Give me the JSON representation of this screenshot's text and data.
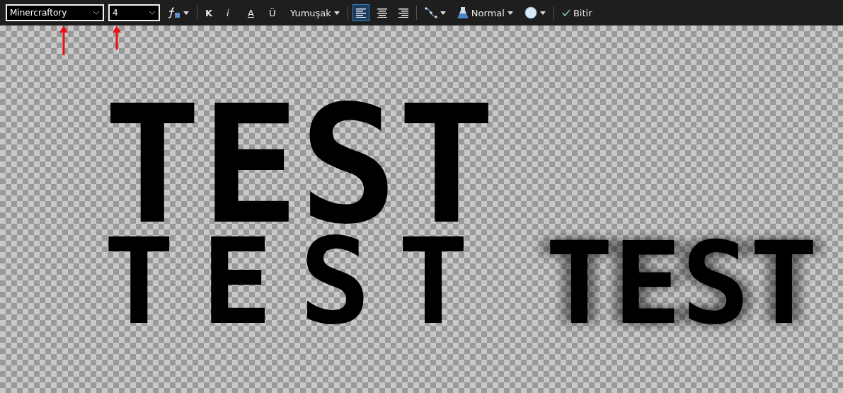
{
  "toolbar": {
    "font_field": {
      "value": "Minercraftory",
      "selected": true
    },
    "size_field": {
      "value": "4"
    },
    "style_buttons": [
      {
        "kind": "bold",
        "label": "K"
      },
      {
        "kind": "italic",
        "label": "i"
      },
      {
        "kind": "underline",
        "label": "A"
      },
      {
        "kind": "strike",
        "label": "Ü"
      }
    ],
    "antialias": "Yumuşak",
    "alignment": [
      {
        "kind": "left",
        "selected": true
      },
      {
        "kind": "center",
        "selected": false
      },
      {
        "kind": "right",
        "selected": false
      }
    ],
    "blend": "Normal",
    "finish": "Bitir"
  },
  "canvas": {
    "texts": [
      {
        "text": "TEST",
        "kind": "large"
      },
      {
        "text": "TEST",
        "kind": "wide"
      },
      {
        "text": "TEST",
        "kind": "shadow"
      }
    ]
  }
}
